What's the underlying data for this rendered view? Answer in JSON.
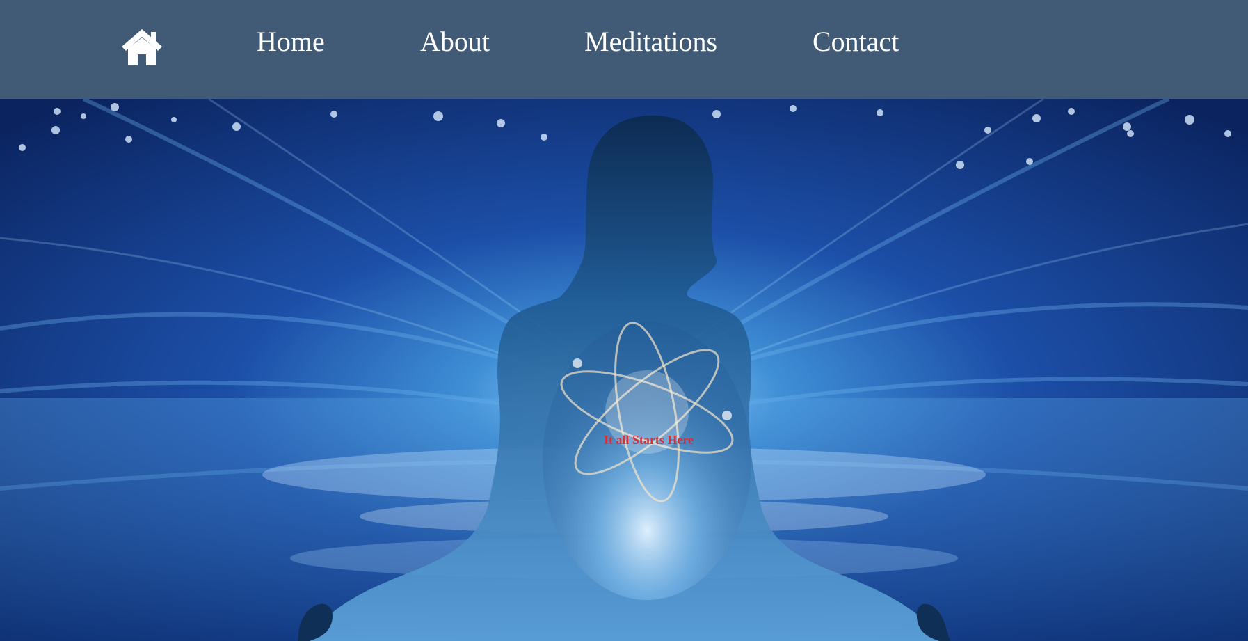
{
  "nav": {
    "home_icon": "home-icon",
    "links": {
      "home": "Home",
      "about": "About",
      "meditations": "Meditations",
      "contact": "Contact"
    }
  },
  "hero": {
    "tagline": "It all Starts Here",
    "tagline_color": "#d6303a",
    "image": "meditating-silhouette-with-atom-glow"
  },
  "colors": {
    "navbar": "#415b77",
    "nav_text": "#ffffff"
  }
}
